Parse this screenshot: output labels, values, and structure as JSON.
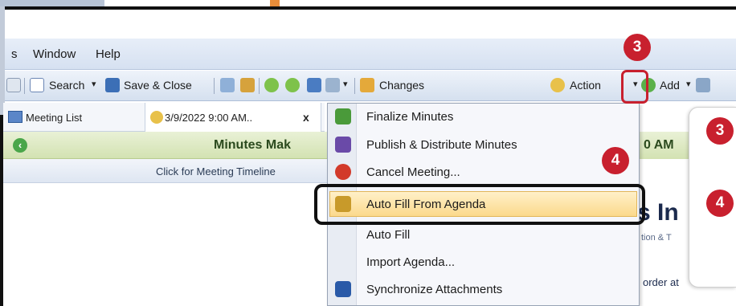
{
  "menubar": {
    "items": [
      "s",
      "Window",
      "Help"
    ]
  },
  "toolbar": {
    "search_label": "Search",
    "save_close_label": "Save & Close",
    "changes_label": "Changes",
    "actions_label": "Action",
    "add_label": "Add",
    "dropdown_arrow": "▾"
  },
  "tabs": {
    "meeting_list": "Meeting List",
    "meeting_tab": "3/9/2022 9:00 AM..",
    "close_glyph": "x"
  },
  "header": {
    "title_fragment": "Minutes Mak",
    "time_fragment": "0 AM",
    "timeline_label": "Click for Meeting Timeline"
  },
  "content": {
    "big_heading_fragment": "s In",
    "sub_fragment": "tion & T",
    "order_label": "order at"
  },
  "dropdown": {
    "items": [
      {
        "label": "Finalize Minutes",
        "icon": "finalize-icon",
        "color": "#4a9a3a"
      },
      {
        "label": "Publish & Distribute Minutes",
        "icon": "publish-icon",
        "color": "#6a4aa8"
      },
      {
        "label": "Cancel Meeting...",
        "icon": "cancel-icon",
        "color": "#d23a2a"
      },
      {
        "label": "Auto Fill From Agenda",
        "icon": "autofill-agenda-icon",
        "color": "#c89a2a"
      },
      {
        "label": "Auto Fill",
        "icon": "",
        "color": ""
      },
      {
        "label": "Import Agenda...",
        "icon": "",
        "color": ""
      },
      {
        "label": "Synchronize Attachments",
        "icon": "sync-icon",
        "color": "#2a5aa8"
      }
    ]
  },
  "callouts": {
    "step3": "3",
    "step4": "4",
    "accent": "#c8202e"
  }
}
